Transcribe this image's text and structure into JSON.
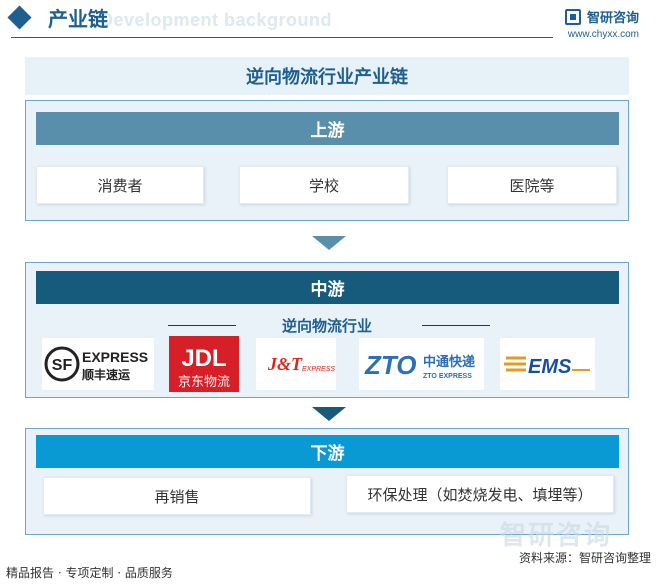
{
  "header": {
    "title": "产业链",
    "watermark": "Development background",
    "brand_name": "智研咨询",
    "brand_url": "www.chyxx.com"
  },
  "main_title": "逆向物流行业产业链",
  "upstream": {
    "label": "上游",
    "items": [
      "消费者",
      "学校",
      "医院等"
    ]
  },
  "midstream": {
    "label": "中游",
    "subtitle": "逆向物流行业",
    "logos": [
      {
        "name": "sf-express",
        "mark": "SF",
        "en": "EXPRESS",
        "cn": "顺丰速运"
      },
      {
        "name": "jdl",
        "mark": "JDL",
        "cn": "京东物流"
      },
      {
        "name": "jt-express",
        "mark": "J&T",
        "en": "EXPRESS"
      },
      {
        "name": "zto",
        "mark": "ZTO",
        "cn": "中通快递",
        "en": "ZTO EXPRESS"
      },
      {
        "name": "ems",
        "mark": "EMS"
      }
    ]
  },
  "downstream": {
    "label": "下游",
    "items": [
      "再销售",
      "环保处理（如焚烧发电、填埋等）"
    ]
  },
  "footer": {
    "left": "精品报告 · 专项定制 · 品质服务",
    "right": "资料来源：智研咨询整理",
    "watermark": "智研咨询"
  },
  "colors": {
    "primary": "#1f5f8f",
    "upstream_bar": "#5a8fab",
    "midstream_bar": "#165b7c",
    "downstream_bar": "#0a9ad3",
    "panel_bg": "#e9f2f9"
  }
}
